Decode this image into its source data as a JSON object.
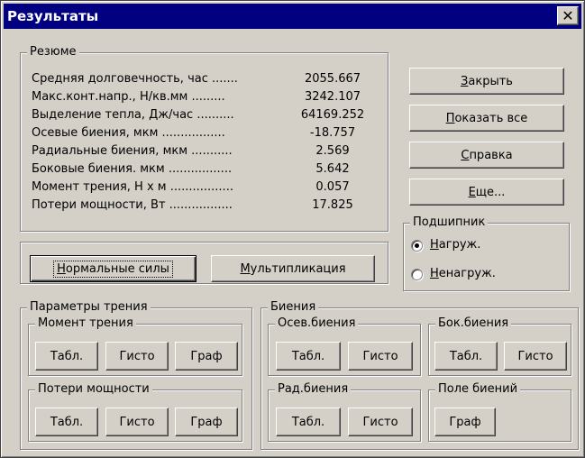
{
  "window": {
    "title": "Результаты",
    "close_glyph": "✕"
  },
  "summary": {
    "legend": "Резюме",
    "rows": [
      {
        "label": "Средняя долговечность, час .......",
        "value": "2055.667"
      },
      {
        "label": "Макс.конт.напр., Н/кв.мм .........",
        "value": "3242.107"
      },
      {
        "label": "Выделение тепла, Дж/час ..........",
        "value": "64169.252"
      },
      {
        "label": "Осевые биения, мкм .................",
        "value": "-18.757"
      },
      {
        "label": "Радиальные биения, мкм ...........",
        "value": "2.569"
      },
      {
        "label": "Боковые биения. мкм .................",
        "value": "5.642"
      },
      {
        "label": "Момент трения, Н х м .................",
        "value": "0.057"
      },
      {
        "label": "Потери мощности, Вт .................",
        "value": "17.825"
      }
    ]
  },
  "actions": {
    "close": {
      "hotkey": "З",
      "rest": "акрыть"
    },
    "show_all": {
      "hotkey": "П",
      "rest": "оказать все"
    },
    "help": {
      "hotkey": "С",
      "rest": "правка"
    },
    "more": {
      "hotkey": "Е",
      "rest": "ще..."
    }
  },
  "bearing": {
    "legend": "Подшипник",
    "loaded": {
      "hotkey": "Н",
      "rest": "агруж.",
      "selected": true
    },
    "unloaded": {
      "hotkey": "Н",
      "rest": "енагруж.",
      "selected": false
    }
  },
  "forces": {
    "normal": {
      "hotkey": "Н",
      "rest": "ормальные силы"
    },
    "multiply": {
      "hotkey": "М",
      "rest": "ультипликация"
    }
  },
  "friction": {
    "legend": "Параметры трения",
    "moment": {
      "legend": "Момент трения",
      "buttons": [
        "Табл.",
        "Гисто",
        "Граф"
      ]
    },
    "power_loss": {
      "legend": "Потери мощности",
      "buttons": [
        "Табл.",
        "Гисто",
        "Граф"
      ]
    }
  },
  "runout": {
    "legend": "Биения",
    "axial": {
      "legend": "Осев.биения",
      "buttons": [
        "Табл.",
        "Гисто"
      ]
    },
    "lateral": {
      "legend": "Бок.биения",
      "buttons": [
        "Табл.",
        "Гисто"
      ]
    },
    "radial": {
      "legend": "Рад.биения",
      "buttons": [
        "Табл.",
        "Гисто"
      ]
    },
    "field": {
      "legend": "Поле биений",
      "buttons": [
        "Граф"
      ]
    }
  },
  "colors": {
    "titlebar": "#000080",
    "face": "#d4d0c8"
  }
}
